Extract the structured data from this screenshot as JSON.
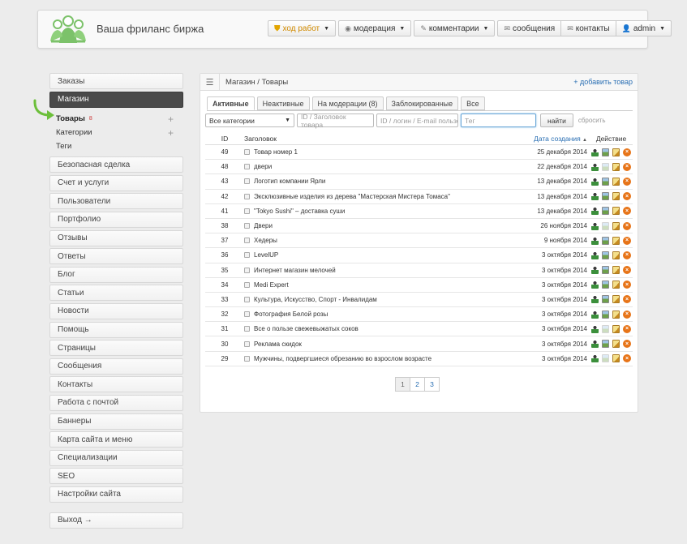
{
  "header": {
    "site_title": "Ваша фриланс биржа",
    "nav": [
      {
        "label": "ход работ",
        "icon": "shield-icon",
        "dropdown": true
      },
      {
        "label": "модерация",
        "icon": "eye-icon",
        "dropdown": true
      },
      {
        "label": "комментарии",
        "icon": "pencil-icon",
        "dropdown": true
      },
      {
        "label": "сообщения",
        "icon": "envelope-icon",
        "dropdown": false
      },
      {
        "label": "контакты",
        "icon": "envelope-icon",
        "dropdown": false
      },
      {
        "label": "admin",
        "icon": "user-icon",
        "dropdown": true
      }
    ]
  },
  "sidebar": {
    "items_top": [
      {
        "label": "Заказы"
      },
      {
        "label": "Магазин",
        "active": true
      }
    ],
    "shop_sub": [
      {
        "label": "Товары",
        "count": "8",
        "plus": true
      },
      {
        "label": "Категории",
        "plus": true
      },
      {
        "label": "Теги",
        "plus": false
      }
    ],
    "items_bottom": [
      {
        "label": "Безопасная сделка"
      },
      {
        "label": "Счет и услуги"
      },
      {
        "label": "Пользователи"
      },
      {
        "label": "Портфолио"
      },
      {
        "label": "Отзывы"
      },
      {
        "label": "Ответы"
      },
      {
        "label": "Блог"
      },
      {
        "label": "Статьи"
      },
      {
        "label": "Новости"
      },
      {
        "label": "Помощь"
      },
      {
        "label": "Страницы"
      },
      {
        "label": "Сообщения"
      },
      {
        "label": "Контакты"
      },
      {
        "label": "Работа с почтой"
      },
      {
        "label": "Баннеры"
      },
      {
        "label": "Карта сайта и меню"
      },
      {
        "label": "Специализации"
      },
      {
        "label": "SEO"
      },
      {
        "label": "Настройки сайта"
      }
    ],
    "logout": "Выход →"
  },
  "main": {
    "breadcrumb": "Магазин / Товары",
    "add_link": "+ добавить товар",
    "tabs": [
      {
        "label": "Активные",
        "active": true
      },
      {
        "label": "Неактивные"
      },
      {
        "label": "На модерации (8)"
      },
      {
        "label": "Заблокированные"
      },
      {
        "label": "Все"
      }
    ],
    "filters": {
      "category_value": "Все категории",
      "title_placeholder": "ID / Заголовок товара",
      "user_placeholder": "ID / логин / E-mail пользователя",
      "tag_placeholder": "Тег",
      "search_label": "найти",
      "reset_label": "сбросить"
    },
    "table": {
      "headers": {
        "id": "ID",
        "title": "Заголовок",
        "date": "Дата создания",
        "sort_indicator": "▲",
        "actions": "Действие"
      },
      "rows": [
        {
          "id": "49",
          "title": "Товар номер 1",
          "date": "25 декабря 2014",
          "img_active": true
        },
        {
          "id": "48",
          "title": "двери",
          "date": "22 декабря 2014",
          "img_active": false
        },
        {
          "id": "43",
          "title": "Логотип компании Ярли",
          "date": "13 декабря 2014",
          "img_active": true
        },
        {
          "id": "42",
          "title": "Эксклюзивные изделия из дерева \"Мастерская Мистера Томаса\"",
          "date": "13 декабря 2014",
          "img_active": true
        },
        {
          "id": "41",
          "title": "\"Tokyo Sushi\" – доставка суши",
          "date": "13 декабря 2014",
          "img_active": true
        },
        {
          "id": "38",
          "title": "Двери",
          "date": "26 ноября 2014",
          "img_active": false
        },
        {
          "id": "37",
          "title": "Хедеры",
          "date": "9 ноября 2014",
          "img_active": true
        },
        {
          "id": "36",
          "title": "LevelUP",
          "date": "3 октября 2014",
          "img_active": true
        },
        {
          "id": "35",
          "title": "Интернет магазин мелочей",
          "date": "3 октября 2014",
          "img_active": true
        },
        {
          "id": "34",
          "title": "Medi Expert",
          "date": "3 октября 2014",
          "img_active": true
        },
        {
          "id": "33",
          "title": "Культура, Искусство, Спорт - Инвалидам",
          "date": "3 октября 2014",
          "img_active": true
        },
        {
          "id": "32",
          "title": "Фотография Белой розы",
          "date": "3 октября 2014",
          "img_active": true
        },
        {
          "id": "31",
          "title": "Все о пользе свежевыжатых соков",
          "date": "3 октября 2014",
          "img_active": false
        },
        {
          "id": "30",
          "title": "Реклама скидок",
          "date": "3 октября 2014",
          "img_active": true
        },
        {
          "id": "29",
          "title": "Мужчины, подвергшиеся обрезанию во взрослом возрасте",
          "date": "3 октября 2014",
          "img_active": false
        }
      ]
    },
    "pagination": [
      "1",
      "2",
      "3"
    ],
    "current_page": "1"
  }
}
